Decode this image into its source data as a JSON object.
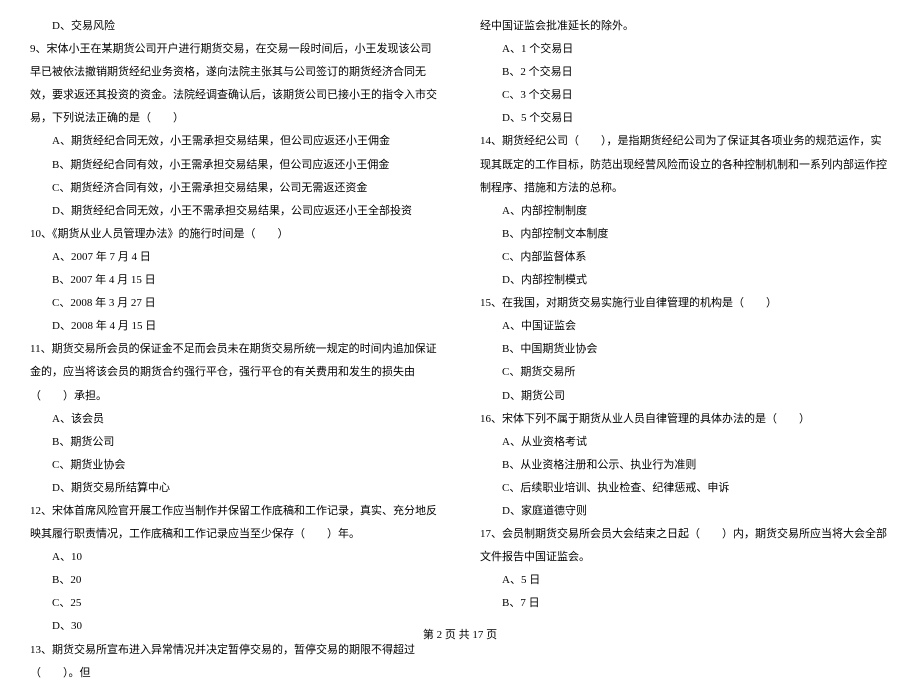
{
  "left": {
    "q8d": "D、交易风险",
    "q9": "9、宋体小王在某期货公司开户进行期货交易，在交易一段时间后，小王发现该公司早已被依法撤销期货经纪业务资格，遂向法院主张其与公司签订的期货经济合同无效，要求返还其投资的资金。法院经调查确认后，该期货公司已接小王的指令入市交易，下列说法正确的是（　　）",
    "q9a": "A、期货经纪合同无效，小王需承担交易结果，但公司应返还小王佣金",
    "q9b": "B、期货经纪合同有效，小王需承担交易结果，但公司应返还小王佣金",
    "q9c": "C、期货经济合同有效，小王需承担交易结果，公司无需返还资金",
    "q9d": "D、期货经纪合同无效，小王不需承担交易结果，公司应返还小王全部投资",
    "q10": "10、《期货从业人员管理办法》的施行时间是（　　）",
    "q10a": "A、2007 年 7 月 4 日",
    "q10b": "B、2007 年 4 月 15 日",
    "q10c": "C、2008 年 3 月 27 日",
    "q10d": "D、2008 年 4 月 15 日",
    "q11": "11、期货交易所会员的保证金不足而会员未在期货交易所统一规定的时间内追加保证金的，应当将该会员的期货合约强行平仓，强行平仓的有关费用和发生的损失由（　　）承担。",
    "q11a": "A、该会员",
    "q11b": "B、期货公司",
    "q11c": "C、期货业协会",
    "q11d": "D、期货交易所结算中心",
    "q12": "12、宋体首席风险官开展工作应当制作并保留工作底稿和工作记录，真实、充分地反映其履行职责情况，工作底稿和工作记录应当至少保存（　　）年。",
    "q12a": "A、10",
    "q12b": "B、20",
    "q12c": "C、25",
    "q12d": "D、30",
    "q13": "13、期货交易所宣布进入异常情况并决定暂停交易的，暂停交易的期限不得超过（　　）。但"
  },
  "right": {
    "q13cont": "经中国证监会批准延长的除外。",
    "q13a": "A、1 个交易日",
    "q13b": "B、2 个交易日",
    "q13c": "C、3 个交易日",
    "q13d": "D、5 个交易日",
    "q14": "14、期货经纪公司（　　），是指期货经纪公司为了保证其各项业务的规范运作，实现其既定的工作目标，防范出现经营风险而设立的各种控制机制和一系列内部运作控制程序、措施和方法的总称。",
    "q14a": "A、内部控制制度",
    "q14b": "B、内部控制文本制度",
    "q14c": "C、内部监督体系",
    "q14d": "D、内部控制模式",
    "q15": "15、在我国，对期货交易实施行业自律管理的机构是（　　）",
    "q15a": "A、中国证监会",
    "q15b": "B、中国期货业协会",
    "q15c": "C、期货交易所",
    "q15d": "D、期货公司",
    "q16": "16、宋体下列不属于期货从业人员自律管理的具体办法的是（　　）",
    "q16a": "A、从业资格考试",
    "q16b": "B、从业资格注册和公示、执业行为准则",
    "q16c": "C、后续职业培训、执业检查、纪律惩戒、申诉",
    "q16d": "D、家庭道德守则",
    "q17": "17、会员制期货交易所会员大会结束之日起（　　）内，期货交易所应当将大会全部文件报告中国证监会。",
    "q17a": "A、5 日",
    "q17b": "B、7 日"
  },
  "footer": "第 2 页 共 17 页"
}
